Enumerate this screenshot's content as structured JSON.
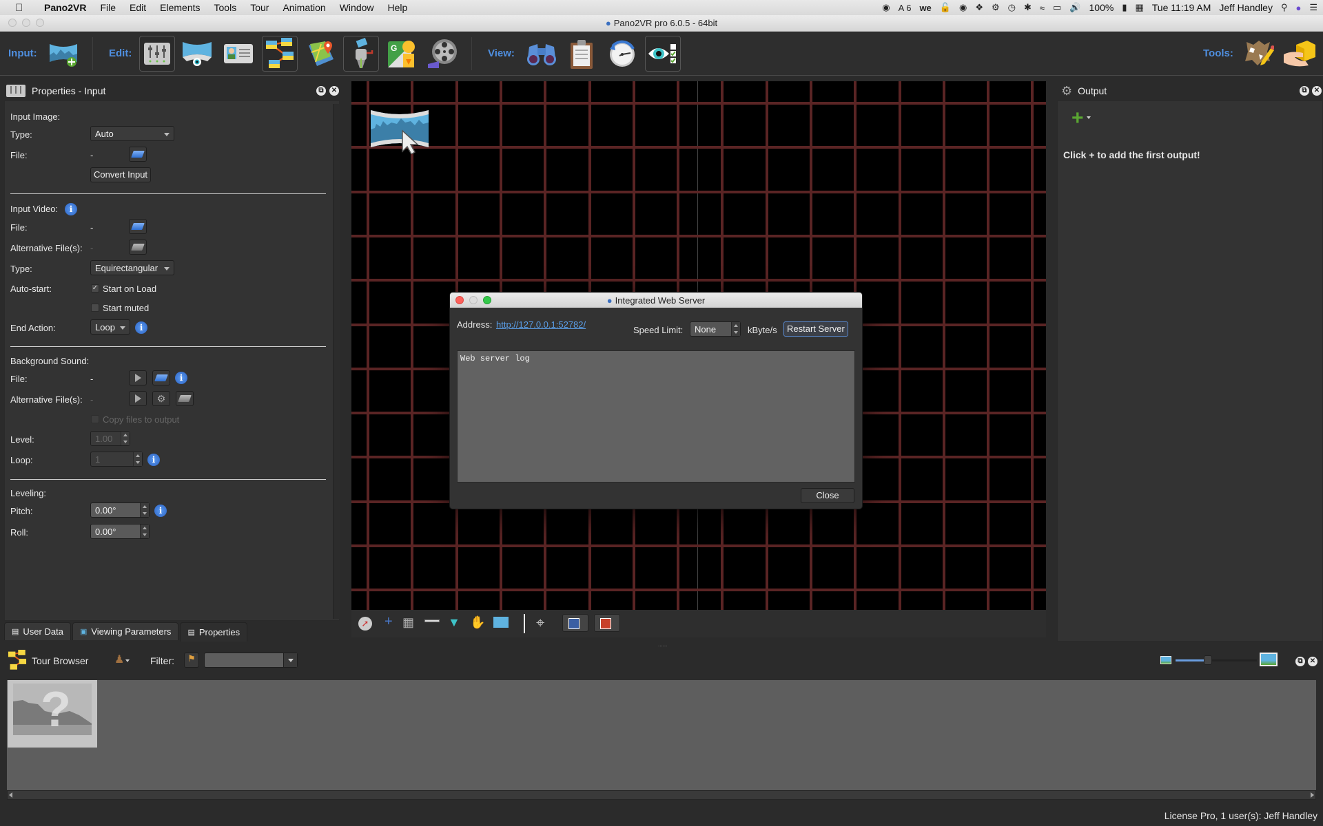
{
  "menubar": {
    "app_name": "Pano2VR",
    "items": [
      "File",
      "Edit",
      "Elements",
      "Tools",
      "Tour",
      "Animation",
      "Window",
      "Help"
    ],
    "status_icons": [
      "evernote-icon",
      "adobe-icon",
      "wechat-icon",
      "lock-icon",
      "webcam-icon",
      "app-icon",
      "sync-icon",
      "time-machine-icon",
      "bluetooth-icon",
      "wifi-icon",
      "airplay-icon",
      "volume-icon"
    ],
    "adobe_count": "6",
    "battery": "100%",
    "clock": "Tue 11:19 AM",
    "user": "Jeff Handley"
  },
  "window": {
    "title": "Pano2VR pro 6.0.5 - 64bit"
  },
  "toolbar": {
    "input_label": "Input:",
    "edit_label": "Edit:",
    "view_label": "View:",
    "tools_label": "Tools:",
    "input_buttons": [
      {
        "name": "add-panorama-icon",
        "tooltip": "Add Input"
      }
    ],
    "edit_buttons": [
      {
        "name": "properties-icon",
        "active": true
      },
      {
        "name": "viewing-parameters-icon",
        "active": false
      },
      {
        "name": "user-data-icon",
        "active": false
      },
      {
        "name": "tour-browser-icon",
        "active": true
      },
      {
        "name": "tour-map-icon",
        "active": false
      },
      {
        "name": "output-icon",
        "active": true
      },
      {
        "name": "google-street-view-icon",
        "active": false
      },
      {
        "name": "animation-icon",
        "active": false
      }
    ],
    "view_buttons": [
      {
        "name": "binoculars-icon",
        "active": false
      },
      {
        "name": "clipboard-icon",
        "active": false
      },
      {
        "name": "history-icon",
        "active": false
      },
      {
        "name": "visibility-icon",
        "active": true
      }
    ],
    "tools_buttons": [
      {
        "name": "skin-editor-icon"
      },
      {
        "name": "package-icon"
      }
    ]
  },
  "properties": {
    "title": "Properties - Input",
    "input_image": {
      "heading": "Input Image:",
      "type_label": "Type:",
      "type_value": "Auto",
      "file_label": "File:",
      "file_value": "-",
      "convert_button": "Convert Input"
    },
    "input_video": {
      "heading": "Input Video:",
      "file_label": "File:",
      "file_value": "-",
      "alt_label": "Alternative File(s):",
      "alt_value": "-",
      "type_label": "Type:",
      "type_value": "Equirectangular",
      "autostart_label": "Auto-start:",
      "start_on_load": "Start on Load",
      "start_on_load_checked": true,
      "start_muted": "Start muted",
      "start_muted_checked": false,
      "end_action_label": "End Action:",
      "end_action_value": "Loop"
    },
    "background_sound": {
      "heading": "Background Sound:",
      "file_label": "File:",
      "file_value": "-",
      "alt_label": "Alternative File(s):",
      "alt_value": "-",
      "copy_files": "Copy files to output",
      "copy_files_checked": false,
      "level_label": "Level:",
      "level_value": "1.00",
      "loop_label": "Loop:",
      "loop_value": "1"
    },
    "leveling": {
      "heading": "Leveling:",
      "pitch_label": "Pitch:",
      "pitch_value": "0.00°",
      "roll_label": "Roll:",
      "roll_value": "0.00°"
    }
  },
  "bottom_tabs": [
    {
      "label": "User Data",
      "selected": false
    },
    {
      "label": "Viewing Parameters",
      "selected": false
    },
    {
      "label": "Properties",
      "selected": true
    }
  ],
  "viewer_tools": [
    "compass-icon",
    "crosshair-line-icon",
    "grid-icon",
    "barrier-icon",
    "field-of-view-icon",
    "hand-icon",
    "panorama-icon",
    "target-icon",
    "blue-color-icon",
    "red-color-icon"
  ],
  "viewer_colors": {
    "grid": "#5a2424",
    "blue": "#3b5fa3",
    "red": "#c8402a"
  },
  "output": {
    "title": "Output",
    "hint": "Click + to add the first output!"
  },
  "tour_browser": {
    "title": "Tour Browser",
    "filter_label": "Filter:",
    "filter_value": "",
    "zoom_slider": 0.4
  },
  "dialog": {
    "title": "Integrated Web Server",
    "address_label": "Address:",
    "address_url": "http://127.0.0.1:52782/",
    "speed_label": "Speed Limit:",
    "speed_value": "None",
    "speed_unit": "kByte/s",
    "restart_button": "Restart Server",
    "log_text": "Web server log",
    "close_button": "Close"
  },
  "statusbar": {
    "license": "License Pro, 1 user(s): Jeff Handley"
  }
}
